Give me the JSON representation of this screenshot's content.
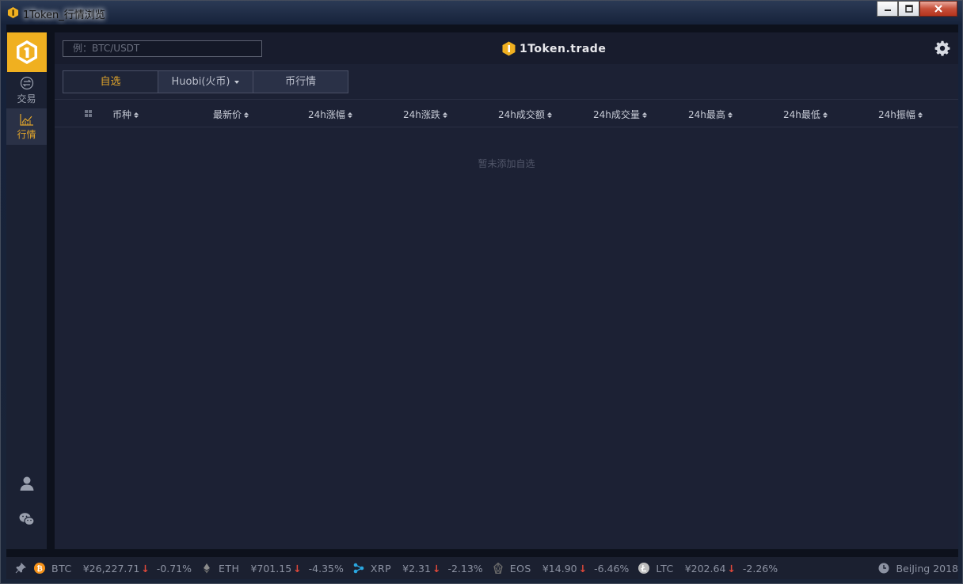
{
  "window": {
    "title": "1Token_行情浏览"
  },
  "sidebar": {
    "items": [
      {
        "label": "交易",
        "icon": "swap-icon"
      },
      {
        "label": "行情",
        "icon": "chart-icon"
      }
    ],
    "bottom_icons": [
      "user-icon",
      "wechat-icon"
    ]
  },
  "header": {
    "search_placeholder": "例：BTC/USDT",
    "brand": "1Token.trade"
  },
  "tabs": [
    {
      "label": "自选",
      "active": true
    },
    {
      "label": "Huobi(火币)",
      "has_dropdown": true
    },
    {
      "label": "币行情"
    }
  ],
  "table": {
    "columns": [
      "币种",
      "最新价",
      "24h涨幅",
      "24h涨跌",
      "24h成交额",
      "24h成交量",
      "24h最高",
      "24h最低",
      "24h振幅"
    ],
    "empty_text": "暂未添加自选"
  },
  "ticker": [
    {
      "symbol": "BTC",
      "price": "¥26,227.71",
      "change": "-0.71%",
      "color": "#f7931a"
    },
    {
      "symbol": "ETH",
      "price": "¥701.15",
      "change": "-4.35%",
      "color": "#8c8c8c"
    },
    {
      "symbol": "XRP",
      "price": "¥2.31",
      "change": "-2.13%",
      "color": "#2aa7e0"
    },
    {
      "symbol": "EOS",
      "price": "¥14.90",
      "change": "-6.46%",
      "color": "#6a6a6a"
    },
    {
      "symbol": "LTC",
      "price": "¥202.64",
      "change": "-2.26%",
      "color": "#bebebe"
    }
  ],
  "clock": {
    "label": "BeiJing 2018"
  },
  "colors": {
    "accent": "#e1a52b",
    "down": "#e0483a",
    "panel": "#1c2134"
  }
}
